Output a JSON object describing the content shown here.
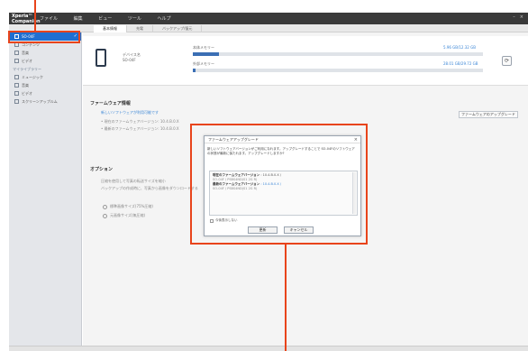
{
  "app": {
    "title": "Xperia™ Companion"
  },
  "menu": [
    "ファイル",
    "編集",
    "ビュー",
    "ツール",
    "ヘルプ"
  ],
  "window_controls": {
    "minimize": "–",
    "close": "×"
  },
  "tabs": [
    "基本情報",
    "充電",
    "バックアップ/復元"
  ],
  "sidebar": {
    "device": {
      "name": "SO-04F",
      "check": "✓"
    },
    "device_items": [
      "コンテンツ",
      "音楽",
      "ビデオ"
    ],
    "section_label": "マイライブラリー",
    "library_items": [
      "ミュージック",
      "音楽",
      "ビデオ",
      "スクリーンアップルム"
    ]
  },
  "device_info": {
    "line1": "デバイス名",
    "line2": "SO-04F",
    "internal_label": "本体メモリー",
    "internal_value": "5.96 GB/12.32 GB",
    "internal_fill": 0.09,
    "sd_label": "外部メモリー",
    "sd_value": "28.01 GB/29.72 GB",
    "sd_fill": 0.01
  },
  "firmware": {
    "title": "ファームウェア情報",
    "link": "新しいソフトウェアが利用可能です",
    "current": "• 現在のファームウェアバージョン: 10.4.B.0.X",
    "latest": "• 最新のファームウェアバージョン: 10.4.B.0.X",
    "button": "ファームウェアのアップグレード"
  },
  "options": {
    "title": "オプション",
    "desc1": "圧縮を使用して写真の転送サイズを縮小",
    "desc2": "バックアップの作成時に、写真から画像をダウンロードする",
    "radio1": "標準画像サイズ(75%圧縮)",
    "radio2": "元画像サイズ(無圧縮)"
  },
  "dialog": {
    "title": "ファームウェアアップグレード",
    "close": "×",
    "message": "新しいソフトウェアバージョンがご利用になれます。アップグレードすることで SO-04Fのソフトウェアの状態が最新に保たれます。アップグレードしますか?",
    "current_label": "現在のファームウェアバージョン",
    "current_value": ": 10.4.B.0.X /",
    "current_sub": "SO-04F / PSBS4ND(S1 2G R)",
    "latest_label": "最新のファームウェアバージョン",
    "latest_value": ": 10.4.B.0.X /",
    "latest_sub": "SO-04F / PSBS4ND(S1 2G R)",
    "checkbox": "今後表示しない",
    "ok": "更新",
    "cancel": "キャンセル"
  },
  "colors": {
    "accent": "#1f6fd1",
    "callout": "#e8441b"
  }
}
